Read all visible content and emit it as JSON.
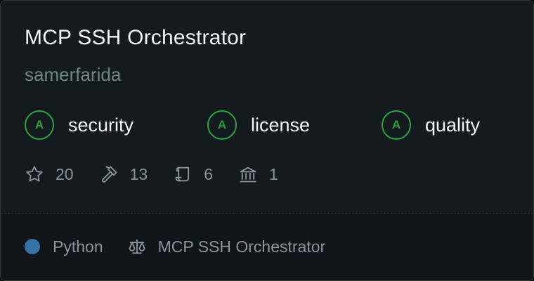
{
  "card": {
    "title": "MCP SSH Orchestrator",
    "owner": "samerfarida"
  },
  "grades": [
    {
      "grade": "A",
      "label": "security"
    },
    {
      "grade": "A",
      "label": "license"
    },
    {
      "grade": "A",
      "label": "quality"
    }
  ],
  "stats": {
    "stars": "20",
    "tools": "13",
    "scrolls": "6",
    "institutions": "1"
  },
  "footer": {
    "language": "Python",
    "language_color": "#3572a5",
    "license_name": "MCP SSH Orchestrator"
  },
  "colors": {
    "grade_accent": "#2ea043",
    "text_primary": "#f0f6fc",
    "text_muted": "#8b949e",
    "owner": "#6e8880"
  },
  "icons": [
    "star-icon",
    "hammer-icon",
    "scroll-icon",
    "bank-icon",
    "scale-icon"
  ]
}
